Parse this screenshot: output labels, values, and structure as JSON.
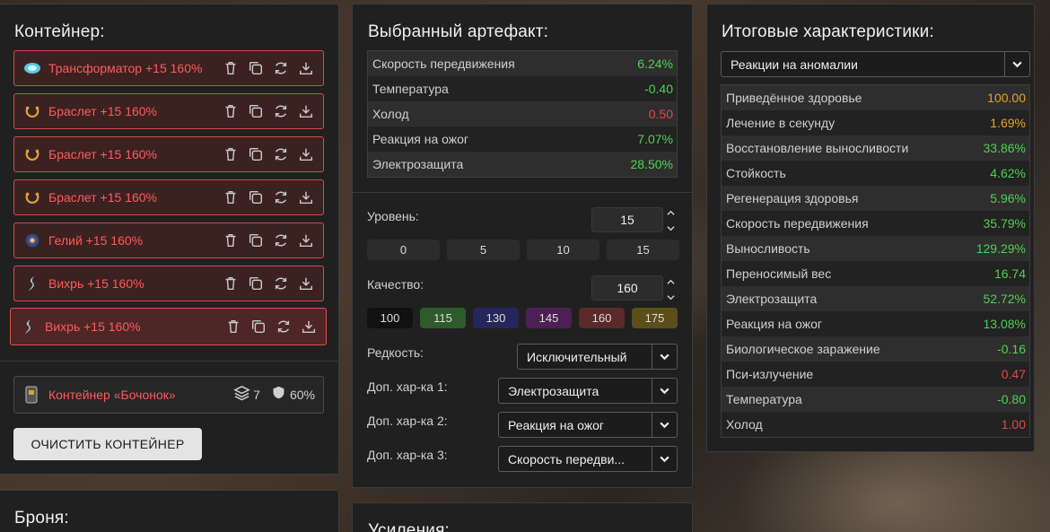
{
  "container": {
    "title": "Контейнер:",
    "items": [
      {
        "label": "Трансформатор +15 160%",
        "icon": "transformer-icon"
      },
      {
        "label": "Браслет +15 160%",
        "icon": "bracelet-icon"
      },
      {
        "label": "Браслет +15 160%",
        "icon": "bracelet-icon"
      },
      {
        "label": "Браслет +15 160%",
        "icon": "bracelet-icon"
      },
      {
        "label": "Гелий +15 160%",
        "icon": "helium-icon"
      },
      {
        "label": "Вихрь +15 160%",
        "icon": "vortex-icon"
      },
      {
        "label": "Вихрь +15 160%",
        "icon": "vortex-icon"
      }
    ],
    "box": {
      "label": "Контейнер «Бочонок»",
      "slots": "7",
      "protection": "60%"
    },
    "clear_label": "ОЧИСТИТЬ КОНТЕЙНЕР"
  },
  "armor": {
    "title": "Броня:"
  },
  "artifact": {
    "title": "Выбранный артефакт:",
    "stats": [
      {
        "name": "Скорость передвижения",
        "value": "6.24%",
        "color": "g"
      },
      {
        "name": "Температура",
        "value": "-0.40",
        "color": "g"
      },
      {
        "name": "Холод",
        "value": "0.50",
        "color": "r"
      },
      {
        "name": "Реакция на ожог",
        "value": "7.07%",
        "color": "g"
      },
      {
        "name": "Электрозащита",
        "value": "28.50%",
        "color": "g"
      }
    ],
    "level_label": "Уровень:",
    "level_value": "15",
    "level_presets": [
      "0",
      "5",
      "10",
      "15"
    ],
    "quality_label": "Качество:",
    "quality_value": "160",
    "quality_presets": [
      {
        "label": "100",
        "color": "#111111"
      },
      {
        "label": "115",
        "color": "#2f5a2a"
      },
      {
        "label": "130",
        "color": "#25275a"
      },
      {
        "label": "145",
        "color": "#4c1f56"
      },
      {
        "label": "160",
        "color": "#5a2a2a"
      },
      {
        "label": "175",
        "color": "#5b4e18"
      }
    ],
    "rarity_label": "Редкость:",
    "rarity_value": "Исключительный",
    "extra1_label": "Доп. хар-ка 1:",
    "extra1_value": "Электрозащита",
    "extra2_label": "Доп. хар-ка 2:",
    "extra2_value": "Реакция на ожог",
    "extra3_label": "Доп. хар-ка 3:",
    "extra3_value": "Скорость передви..."
  },
  "boosts": {
    "title": "Усиления:"
  },
  "totals": {
    "title": "Итоговые характеристики:",
    "filter_value": "Реакции на аномалии",
    "stats": [
      {
        "name": "Приведённое здоровье",
        "value": "100.00",
        "color": "o"
      },
      {
        "name": "Лечение в секунду",
        "value": "1.69%",
        "color": "o"
      },
      {
        "name": "Восстановление выносливости",
        "value": "33.86%",
        "color": "g"
      },
      {
        "name": "Стойкость",
        "value": "4.62%",
        "color": "g"
      },
      {
        "name": "Регенерация здоровья",
        "value": "5.96%",
        "color": "g"
      },
      {
        "name": "Скорость передвижения",
        "value": "35.79%",
        "color": "g"
      },
      {
        "name": "Выносливость",
        "value": "129.29%",
        "color": "g"
      },
      {
        "name": "Переносимый вес",
        "value": "16.74",
        "color": "g"
      },
      {
        "name": "Электрозащита",
        "value": "52.72%",
        "color": "g"
      },
      {
        "name": "Реакция на ожог",
        "value": "13.08%",
        "color": "g"
      },
      {
        "name": "Биологическое заражение",
        "value": "-0.16",
        "color": "g"
      },
      {
        "name": "Пси-излучение",
        "value": "0.47",
        "color": "r"
      },
      {
        "name": "Температура",
        "value": "-0.80",
        "color": "g"
      },
      {
        "name": "Холод",
        "value": "1.00",
        "color": "r"
      }
    ]
  }
}
